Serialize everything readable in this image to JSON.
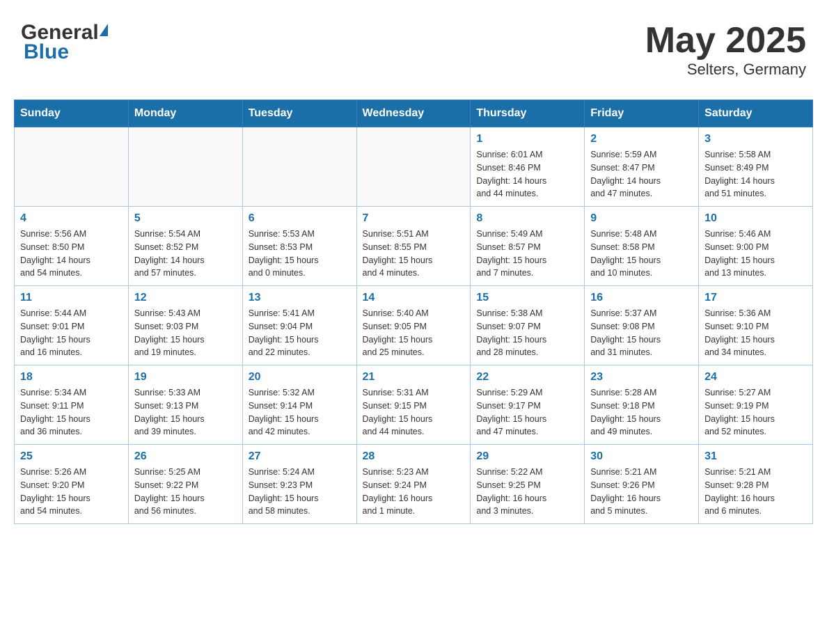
{
  "header": {
    "logo_general": "General",
    "logo_blue": "Blue",
    "title": "May 2025",
    "subtitle": "Selters, Germany"
  },
  "calendar": {
    "days_of_week": [
      "Sunday",
      "Monday",
      "Tuesday",
      "Wednesday",
      "Thursday",
      "Friday",
      "Saturday"
    ],
    "weeks": [
      [
        {
          "day": "",
          "info": ""
        },
        {
          "day": "",
          "info": ""
        },
        {
          "day": "",
          "info": ""
        },
        {
          "day": "",
          "info": ""
        },
        {
          "day": "1",
          "info": "Sunrise: 6:01 AM\nSunset: 8:46 PM\nDaylight: 14 hours\nand 44 minutes."
        },
        {
          "day": "2",
          "info": "Sunrise: 5:59 AM\nSunset: 8:47 PM\nDaylight: 14 hours\nand 47 minutes."
        },
        {
          "day": "3",
          "info": "Sunrise: 5:58 AM\nSunset: 8:49 PM\nDaylight: 14 hours\nand 51 minutes."
        }
      ],
      [
        {
          "day": "4",
          "info": "Sunrise: 5:56 AM\nSunset: 8:50 PM\nDaylight: 14 hours\nand 54 minutes."
        },
        {
          "day": "5",
          "info": "Sunrise: 5:54 AM\nSunset: 8:52 PM\nDaylight: 14 hours\nand 57 minutes."
        },
        {
          "day": "6",
          "info": "Sunrise: 5:53 AM\nSunset: 8:53 PM\nDaylight: 15 hours\nand 0 minutes."
        },
        {
          "day": "7",
          "info": "Sunrise: 5:51 AM\nSunset: 8:55 PM\nDaylight: 15 hours\nand 4 minutes."
        },
        {
          "day": "8",
          "info": "Sunrise: 5:49 AM\nSunset: 8:57 PM\nDaylight: 15 hours\nand 7 minutes."
        },
        {
          "day": "9",
          "info": "Sunrise: 5:48 AM\nSunset: 8:58 PM\nDaylight: 15 hours\nand 10 minutes."
        },
        {
          "day": "10",
          "info": "Sunrise: 5:46 AM\nSunset: 9:00 PM\nDaylight: 15 hours\nand 13 minutes."
        }
      ],
      [
        {
          "day": "11",
          "info": "Sunrise: 5:44 AM\nSunset: 9:01 PM\nDaylight: 15 hours\nand 16 minutes."
        },
        {
          "day": "12",
          "info": "Sunrise: 5:43 AM\nSunset: 9:03 PM\nDaylight: 15 hours\nand 19 minutes."
        },
        {
          "day": "13",
          "info": "Sunrise: 5:41 AM\nSunset: 9:04 PM\nDaylight: 15 hours\nand 22 minutes."
        },
        {
          "day": "14",
          "info": "Sunrise: 5:40 AM\nSunset: 9:05 PM\nDaylight: 15 hours\nand 25 minutes."
        },
        {
          "day": "15",
          "info": "Sunrise: 5:38 AM\nSunset: 9:07 PM\nDaylight: 15 hours\nand 28 minutes."
        },
        {
          "day": "16",
          "info": "Sunrise: 5:37 AM\nSunset: 9:08 PM\nDaylight: 15 hours\nand 31 minutes."
        },
        {
          "day": "17",
          "info": "Sunrise: 5:36 AM\nSunset: 9:10 PM\nDaylight: 15 hours\nand 34 minutes."
        }
      ],
      [
        {
          "day": "18",
          "info": "Sunrise: 5:34 AM\nSunset: 9:11 PM\nDaylight: 15 hours\nand 36 minutes."
        },
        {
          "day": "19",
          "info": "Sunrise: 5:33 AM\nSunset: 9:13 PM\nDaylight: 15 hours\nand 39 minutes."
        },
        {
          "day": "20",
          "info": "Sunrise: 5:32 AM\nSunset: 9:14 PM\nDaylight: 15 hours\nand 42 minutes."
        },
        {
          "day": "21",
          "info": "Sunrise: 5:31 AM\nSunset: 9:15 PM\nDaylight: 15 hours\nand 44 minutes."
        },
        {
          "day": "22",
          "info": "Sunrise: 5:29 AM\nSunset: 9:17 PM\nDaylight: 15 hours\nand 47 minutes."
        },
        {
          "day": "23",
          "info": "Sunrise: 5:28 AM\nSunset: 9:18 PM\nDaylight: 15 hours\nand 49 minutes."
        },
        {
          "day": "24",
          "info": "Sunrise: 5:27 AM\nSunset: 9:19 PM\nDaylight: 15 hours\nand 52 minutes."
        }
      ],
      [
        {
          "day": "25",
          "info": "Sunrise: 5:26 AM\nSunset: 9:20 PM\nDaylight: 15 hours\nand 54 minutes."
        },
        {
          "day": "26",
          "info": "Sunrise: 5:25 AM\nSunset: 9:22 PM\nDaylight: 15 hours\nand 56 minutes."
        },
        {
          "day": "27",
          "info": "Sunrise: 5:24 AM\nSunset: 9:23 PM\nDaylight: 15 hours\nand 58 minutes."
        },
        {
          "day": "28",
          "info": "Sunrise: 5:23 AM\nSunset: 9:24 PM\nDaylight: 16 hours\nand 1 minute."
        },
        {
          "day": "29",
          "info": "Sunrise: 5:22 AM\nSunset: 9:25 PM\nDaylight: 16 hours\nand 3 minutes."
        },
        {
          "day": "30",
          "info": "Sunrise: 5:21 AM\nSunset: 9:26 PM\nDaylight: 16 hours\nand 5 minutes."
        },
        {
          "day": "31",
          "info": "Sunrise: 5:21 AM\nSunset: 9:28 PM\nDaylight: 16 hours\nand 6 minutes."
        }
      ]
    ]
  }
}
